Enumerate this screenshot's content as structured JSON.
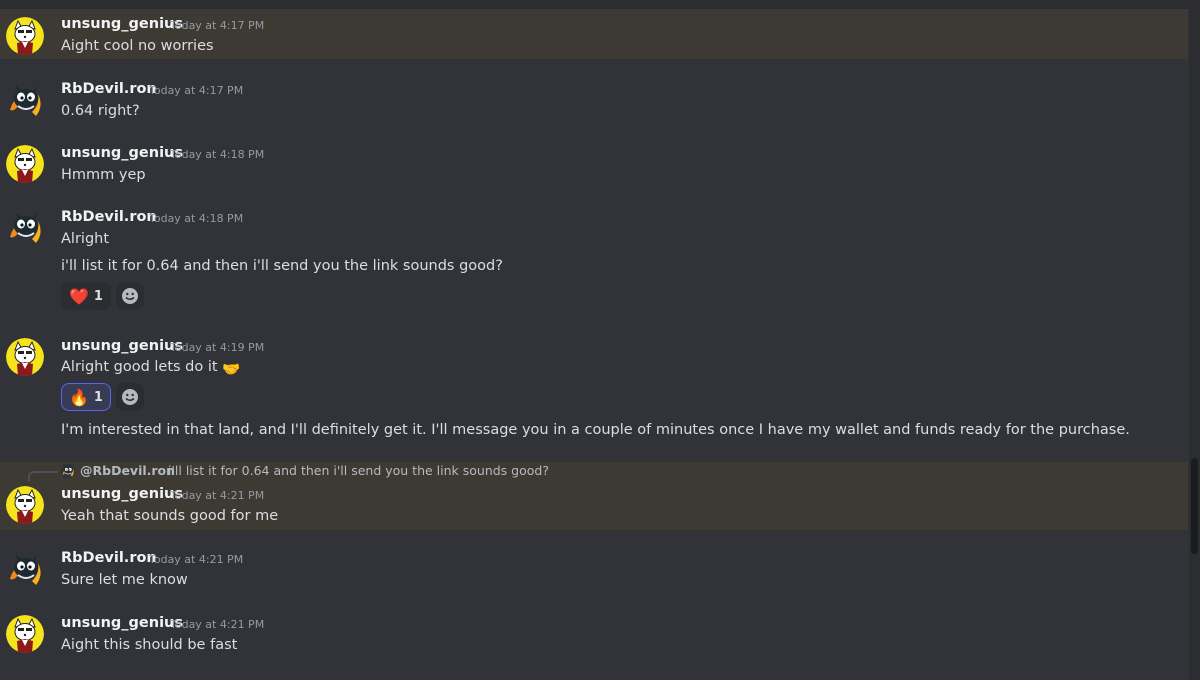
{
  "colors": {
    "background": "#313338",
    "highlight": "#3c3a32",
    "username": "#f2f3f5",
    "timestamp": "#949ba4",
    "text": "#dbdee1",
    "reaction_active_border": "#5865f2"
  },
  "messages": [
    {
      "author": "unsung_genius",
      "avatar": "cat-avatar",
      "time": "Today at 4:17 PM",
      "lines": [
        "Aight cool no worries"
      ],
      "highlighted": true
    },
    {
      "author": "RbDevil.ron",
      "avatar": "devil-avatar",
      "time": "Today at 4:17 PM",
      "lines": [
        "0.64 right?"
      ]
    },
    {
      "author": "unsung_genius",
      "avatar": "cat-avatar",
      "time": "Today at 4:18 PM",
      "lines": [
        "Hmmm yep"
      ]
    },
    {
      "author": "RbDevil.ron",
      "avatar": "devil-avatar",
      "time": "Today at 4:18 PM",
      "lines": [
        "Alright",
        "i'll list it for 0.64 and then i'll send you the link sounds good?"
      ],
      "reactions": [
        {
          "emoji": "heart",
          "emoji_char": "❤️",
          "count": "1",
          "active": false
        }
      ]
    },
    {
      "author": "unsung_genius",
      "avatar": "cat-avatar",
      "time": "Today at 4:19 PM",
      "lines": [
        "Alright good lets do it",
        "I'm interested in that land, and I'll definitely get it. I'll message you in a couple of minutes once I have my wallet and funds ready for the purchase."
      ],
      "inline_emoji": "handshake",
      "inline_emoji_char": "🤝",
      "reactions": [
        {
          "emoji": "fire",
          "emoji_char": "🔥",
          "count": "1",
          "active": true
        }
      ]
    },
    {
      "author": "unsung_genius",
      "avatar": "cat-avatar",
      "time": "Today at 4:21 PM",
      "lines": [
        "Yeah that sounds good for me"
      ],
      "highlighted": true,
      "reply": {
        "name": "@RbDevil.ron",
        "text": "i'll list it for 0.64 and then i'll send you the link sounds good?"
      }
    },
    {
      "author": "RbDevil.ron",
      "avatar": "devil-avatar",
      "time": "Today at 4:21 PM",
      "lines": [
        "Sure let me know"
      ]
    },
    {
      "author": "unsung_genius",
      "avatar": "cat-avatar",
      "time": "Today at 4:21 PM",
      "lines": [
        "Aight this should be fast"
      ]
    }
  ]
}
